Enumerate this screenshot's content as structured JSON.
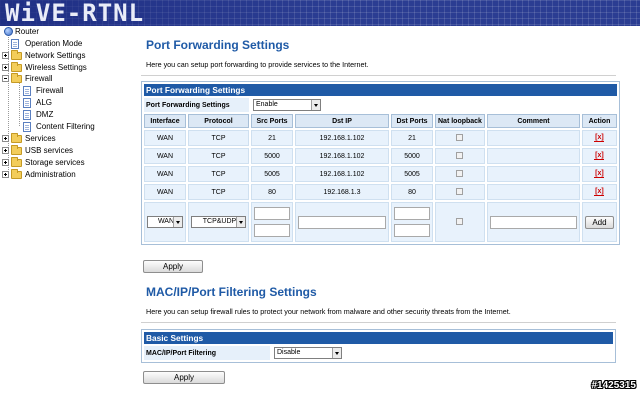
{
  "banner": {
    "logo": "WiVE-RTNL"
  },
  "tree": {
    "root": "Router",
    "items": [
      {
        "label": "Operation Mode",
        "type": "page"
      },
      {
        "label": "Network Settings",
        "type": "folder"
      },
      {
        "label": "Wireless Settings",
        "type": "folder"
      },
      {
        "label": "Firewall",
        "type": "folder"
      },
      {
        "label": "Firewall",
        "type": "page"
      },
      {
        "label": "ALG",
        "type": "page"
      },
      {
        "label": "DMZ",
        "type": "page"
      },
      {
        "label": "Content Filtering",
        "type": "page"
      },
      {
        "label": "Services",
        "type": "folder"
      },
      {
        "label": "USB services",
        "type": "folder"
      },
      {
        "label": "Storage services",
        "type": "folder"
      },
      {
        "label": "Administration",
        "type": "folder"
      }
    ]
  },
  "port_forwarding": {
    "title": "Port Forwarding Settings",
    "description": "Here you can setup port forwarding to provide services to the Internet.",
    "section_header": "Port Forwarding Settings",
    "setting_label": "Port Forwarding Settings",
    "setting_value": "Enable",
    "columns": [
      "Interface",
      "Protocol",
      "Src Ports",
      "Dst IP",
      "Dst Ports",
      "Nat loopback",
      "Comment",
      "Action"
    ],
    "rows": [
      {
        "interface": "WAN",
        "protocol": "TCP",
        "src_ports": "21",
        "dst_ip": "192.168.1.102",
        "dst_ports": "21",
        "nat_loopback": false,
        "comment": "",
        "action": "[x]"
      },
      {
        "interface": "WAN",
        "protocol": "TCP",
        "src_ports": "5000",
        "dst_ip": "192.168.1.102",
        "dst_ports": "5000",
        "nat_loopback": false,
        "comment": "",
        "action": "[x]"
      },
      {
        "interface": "WAN",
        "protocol": "TCP",
        "src_ports": "5005",
        "dst_ip": "192.168.1.102",
        "dst_ports": "5005",
        "nat_loopback": false,
        "comment": "",
        "action": "[x]"
      },
      {
        "interface": "WAN",
        "protocol": "TCP",
        "src_ports": "80",
        "dst_ip": "192.168.1.3",
        "dst_ports": "80",
        "nat_loopback": false,
        "comment": "",
        "action": "[x]"
      }
    ],
    "new_row": {
      "interface": "WAN",
      "protocol": "TCP&UDP",
      "add_label": "Add"
    },
    "apply_label": "Apply"
  },
  "mac_filtering": {
    "title": "MAC/IP/Port Filtering Settings",
    "description": "Here you can setup firewall rules to protect your network from malware and other security threats from the Internet.",
    "section_header": "Basic Settings",
    "setting_label": "MAC/IP/Port Filtering",
    "setting_value": "Disable",
    "apply_label": "Apply"
  },
  "watermark": "#1425315",
  "colors": {
    "accent": "#1f5aa6",
    "banner": "#2b3d92",
    "delete": "#cc0000"
  }
}
